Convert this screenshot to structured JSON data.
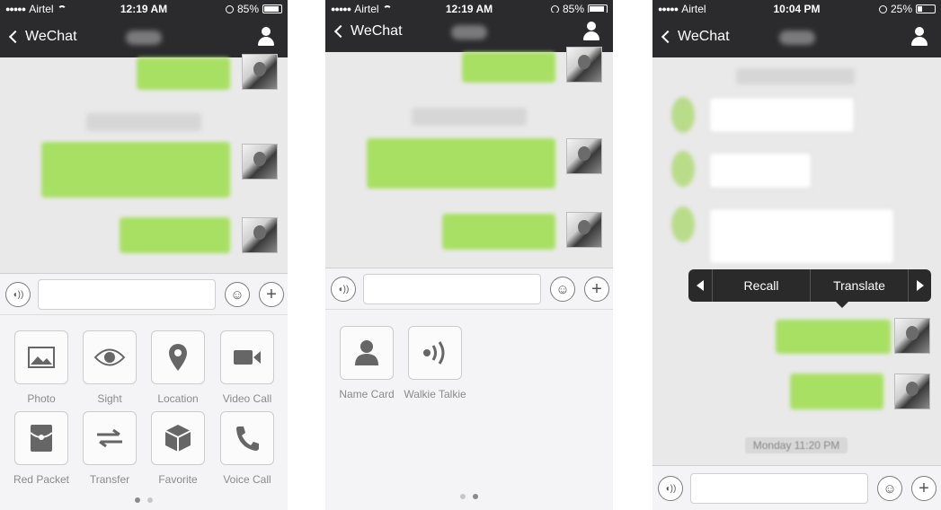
{
  "colors": {
    "navbar": "#2b2b2d",
    "bubble_green": "#a8e063",
    "chat_bg": "#e9e9e9",
    "panel_bg": "#f4f4f6"
  },
  "screens": [
    {
      "status": {
        "carrier": "Airtel",
        "time": "12:19 AM",
        "battery": "85%",
        "battery_level": 0.85
      },
      "nav": {
        "back_label": "WeChat"
      },
      "tools": [
        {
          "label": "Photo",
          "icon": "image-icon"
        },
        {
          "label": "Sight",
          "icon": "eye-icon"
        },
        {
          "label": "Location",
          "icon": "location-pin-icon"
        },
        {
          "label": "Video Call",
          "icon": "video-camera-icon"
        },
        {
          "label": "Red Packet",
          "icon": "red-packet-icon"
        },
        {
          "label": "Transfer",
          "icon": "transfer-arrows-icon"
        },
        {
          "label": "Favorite",
          "icon": "cube-icon"
        },
        {
          "label": "Voice Call",
          "icon": "phone-icon"
        }
      ]
    },
    {
      "status": {
        "carrier": "Airtel",
        "time": "12:19 AM",
        "battery": "85%",
        "battery_level": 0.85
      },
      "nav": {
        "back_label": "WeChat"
      },
      "tools": [
        {
          "label": "Name Card",
          "icon": "person-icon"
        },
        {
          "label": "Walkie Talkie",
          "icon": "walkie-talkie-icon"
        }
      ]
    },
    {
      "status": {
        "carrier": "Airtel",
        "time": "10:04 PM",
        "battery": "25%",
        "battery_level": 0.25
      },
      "nav": {
        "back_label": "WeChat"
      },
      "context_menu": {
        "recall": "Recall",
        "translate": "Translate"
      },
      "timestamp": "Monday 11:20 PM"
    }
  ]
}
